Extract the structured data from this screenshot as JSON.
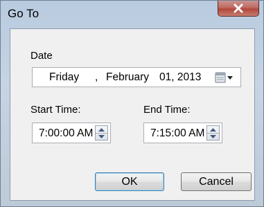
{
  "window": {
    "title": "Go To",
    "close_icon": "close-icon"
  },
  "date": {
    "label": "Date",
    "day_of_week": "Friday",
    "separator": ",",
    "month": "February",
    "day": "01, 2013",
    "calendar_icon": "calendar-dropdown-icon"
  },
  "start_time": {
    "label": "Start Time:",
    "value": "7:00:00 AM"
  },
  "end_time": {
    "label": "End Time:",
    "value": "7:15:00 AM"
  },
  "buttons": {
    "ok": "OK",
    "cancel": "Cancel"
  },
  "colors": {
    "close_button": "#c0463a",
    "default_button_border": "#3c7fb1"
  }
}
